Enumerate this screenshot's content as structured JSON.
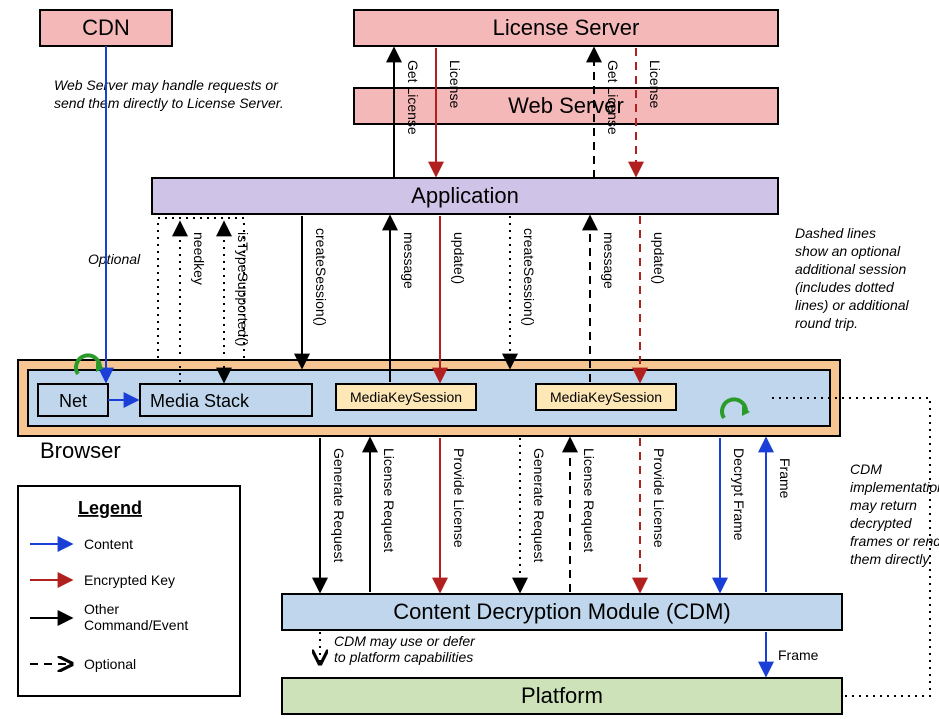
{
  "boxes": {
    "cdn": "CDN",
    "license_server": "License Server",
    "web_server": "Web Server",
    "application": "Application",
    "net": "Net",
    "media_stack": "Media Stack",
    "mks1": "MediaKeySession",
    "mks2": "MediaKeySession",
    "browser": "Browser",
    "cdm": "Content Decryption Module (CDM)",
    "platform": "Platform"
  },
  "notes": {
    "web_server_note_l1": "Web Server may handle requests or",
    "web_server_note_l2": "send them directly to License Server.",
    "optional": "Optional",
    "dashed_l1": "Dashed lines",
    "dashed_l2": "show an optional",
    "dashed_l3": "additional session",
    "dashed_l4": "(includes dotted",
    "dashed_l5": "lines) or additional",
    "dashed_l6": "round trip.",
    "cdm_l1": "CDM",
    "cdm_l2": "implementations",
    "cdm_l3": "may return",
    "cdm_l4": "decrypted",
    "cdm_l5": "frames or render",
    "cdm_l6": "them directly.",
    "cdm_defer_l1": "CDM may use or defer",
    "cdm_defer_l2": "to platform capabilities",
    "frame_right": "Frame"
  },
  "arrows_top": {
    "get_license_1": "Get License",
    "license_1": "License",
    "get_license_2": "Get License",
    "license_2": "License"
  },
  "arrows_mid": {
    "needkey": "needkey",
    "istype": "isTypeSupported()",
    "create1": "createSession()",
    "message1": "message",
    "update1": "update()",
    "create2": "createSession()",
    "message2": "message",
    "update2": "update()"
  },
  "arrows_low": {
    "genreq1": "Generate Request",
    "licreq1": "License Request",
    "provlic1": "Provide License",
    "genreq2": "Generate Request",
    "licreq2": "License Request",
    "provlic2": "Provide License",
    "decrypt": "Decrypt Frame",
    "frame": "Frame"
  },
  "legend": {
    "title": "Legend",
    "content": "Content",
    "encrypted": "Encrypted Key",
    "other_l1": "Other",
    "other_l2": "Command/Event",
    "optional": "Optional"
  }
}
